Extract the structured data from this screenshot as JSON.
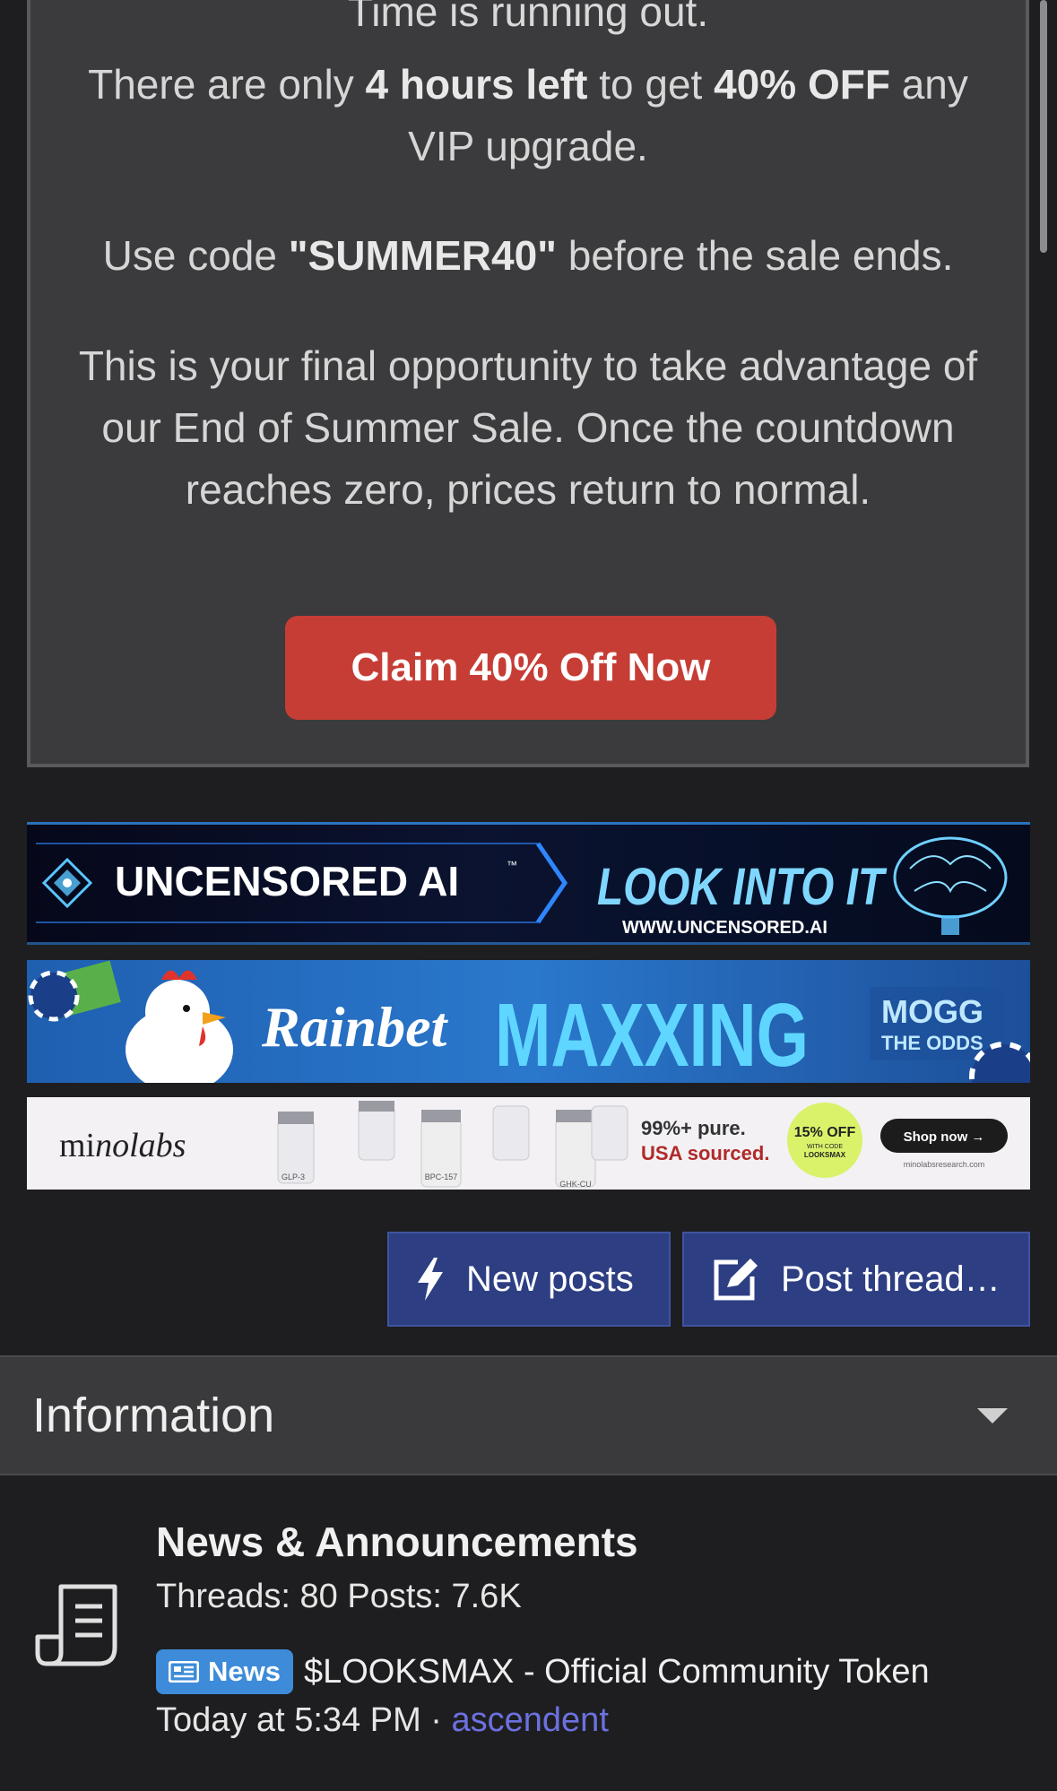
{
  "promo": {
    "cut_heading": "Time is running out.",
    "line1_a": "There are only ",
    "line1_b": "4 hours left",
    "line1_c": " to get ",
    "line1_d": "40% OFF",
    "line1_e": " any VIP upgrade.",
    "line2_a": "Use code ",
    "line2_b": "\"SUMMER40\"",
    "line2_c": " before the sale ends.",
    "line3": "This is your final opportunity to take advantage of our End of Summer Sale. Once the countdown reaches zero, prices return to normal.",
    "button": "Claim 40% Off Now",
    "button_color": "#c63d35"
  },
  "banners": {
    "b1": {
      "left_text": "UNCENSORED AI",
      "tm": "™",
      "headline": "LOOK INTO IT",
      "url": "WWW.UNCENSORED.AI"
    },
    "b2": {
      "brand": "Rainbet",
      "headline": "MAXXING",
      "tag1": "MOGG",
      "tag2": "THE ODDS"
    },
    "b3": {
      "brand_a": "mi",
      "brand_b": "nolabs",
      "vial1": "GLP-3",
      "vial2": "BPC-157",
      "vial3": "GHK-CU",
      "line1": "99%+ pure.",
      "line2": "USA sourced.",
      "badge1": "15% OFF",
      "badge2": "WITH CODE",
      "badge3": "LOOKSMAX",
      "cta": "Shop now →",
      "url": "minolabsresearch.com"
    }
  },
  "actions": {
    "new_posts": "New posts",
    "post_thread": "Post thread…",
    "accent": "#2d3e83"
  },
  "section": {
    "title": "Information"
  },
  "forum": {
    "title": "News & Announcements",
    "stats": "Threads: 80 Posts: 7.6K",
    "badge": "News",
    "latest_title": "$LOOKSMAX - Official Community Token",
    "latest_time": "Today at 5:34 PM",
    "separator": "·",
    "latest_author": "ascendent"
  }
}
